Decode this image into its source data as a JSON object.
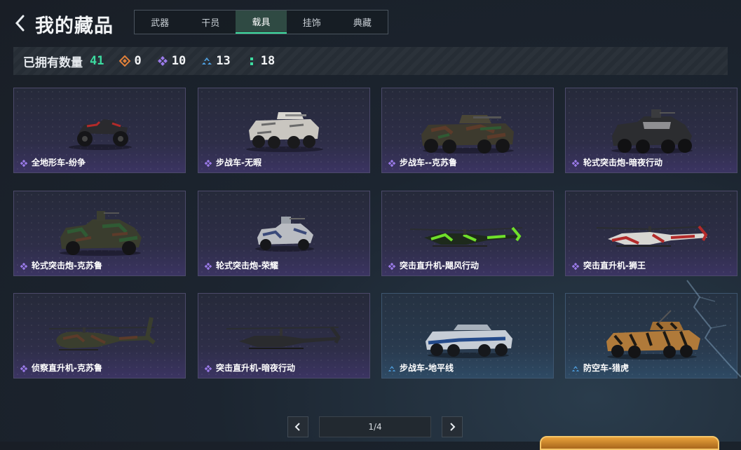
{
  "header": {
    "title": "我的藏品",
    "tabs": [
      {
        "label": "武器",
        "active": false
      },
      {
        "label": "干员",
        "active": false
      },
      {
        "label": "载具",
        "active": true
      },
      {
        "label": "挂饰",
        "active": false
      },
      {
        "label": "典藏",
        "active": false
      }
    ]
  },
  "summary": {
    "label": "已拥有数量",
    "total": "41",
    "rarities": [
      {
        "icon": "orange-diamond-icon",
        "color": "#e0803a",
        "count": "0"
      },
      {
        "icon": "purple-diamond-icon",
        "color": "#9b7bea",
        "count": "10"
      },
      {
        "icon": "blue-chevron-icon",
        "color": "#4fa3e6",
        "count": "13"
      },
      {
        "icon": "green-dots-icon",
        "color": "#3ddba0",
        "count": "18"
      }
    ]
  },
  "items": [
    {
      "name": "全地形车-纷争",
      "rarity": "purple"
    },
    {
      "name": "步战车-无暇",
      "rarity": "purple"
    },
    {
      "name": "步战车--克苏鲁",
      "rarity": "purple"
    },
    {
      "name": "轮式突击炮-暗夜行动",
      "rarity": "purple"
    },
    {
      "name": "轮式突击炮-克苏鲁",
      "rarity": "purple"
    },
    {
      "name": "轮式突击炮-荣耀",
      "rarity": "purple"
    },
    {
      "name": "突击直升机-飓风行动",
      "rarity": "purple"
    },
    {
      "name": "突击直升机-狮王",
      "rarity": "purple"
    },
    {
      "name": "侦察直升机-克苏鲁",
      "rarity": "purple"
    },
    {
      "name": "突击直升机-暗夜行动",
      "rarity": "purple"
    },
    {
      "name": "步战车-地平线",
      "rarity": "blue"
    },
    {
      "name": "防空车-猎虎",
      "rarity": "blue"
    }
  ],
  "pagination": {
    "text": "1/4"
  },
  "colors": {
    "accent": "#3ddba0",
    "purple": "#9b7bea",
    "blue": "#4fa3e6"
  }
}
